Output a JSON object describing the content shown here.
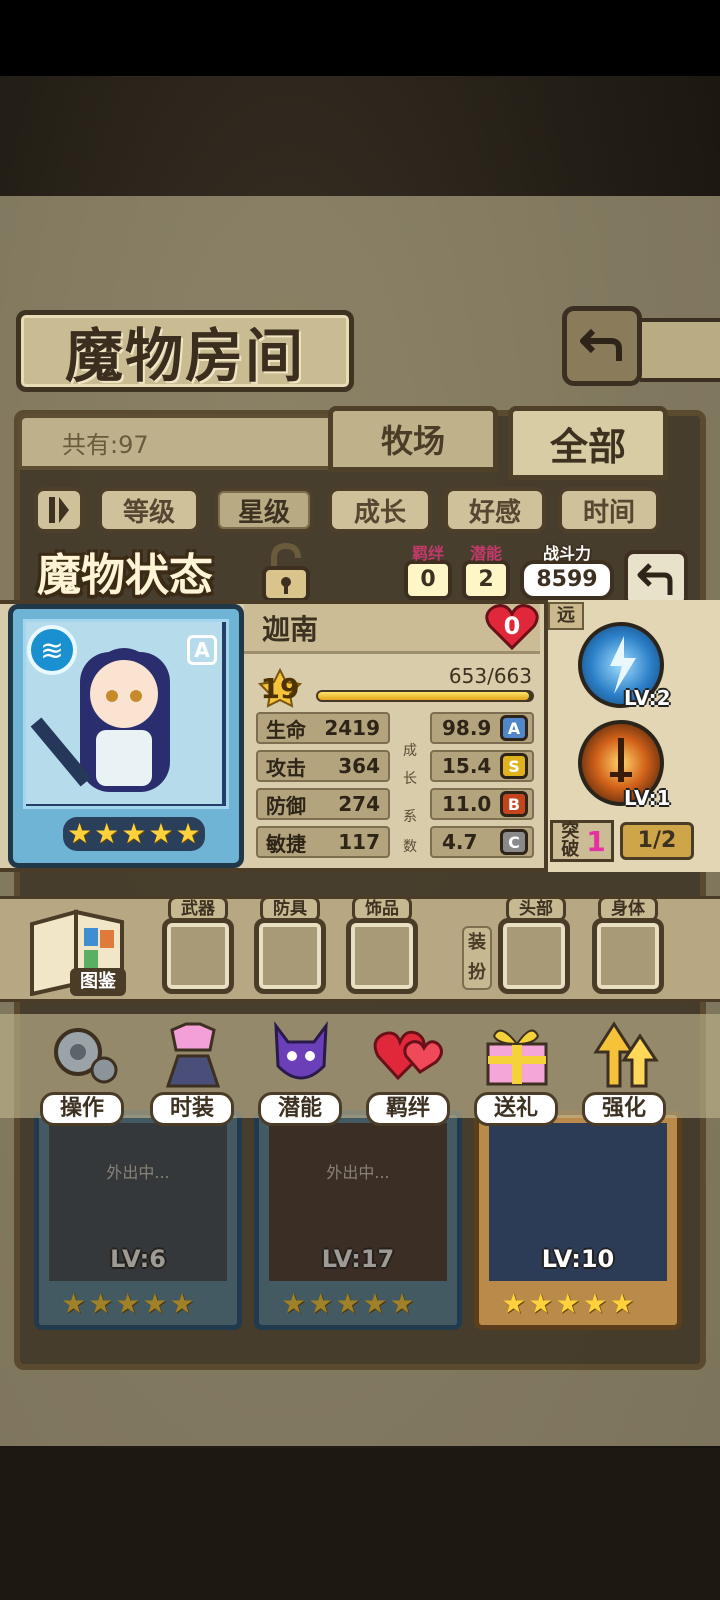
{
  "screen": {
    "title": "魔物房间",
    "count_label": "共有:97",
    "tabs": [
      "牧场",
      "全部"
    ],
    "sort_options": [
      "等级",
      "星级",
      "成长",
      "好感",
      "时间"
    ],
    "active_sort": "星级"
  },
  "status": {
    "title": "魔物状态",
    "bond_label": "羁绊",
    "bond_value": "0",
    "potential_label": "潜能",
    "potential_value": "2",
    "power_label": "战斗力",
    "power_value": "8599"
  },
  "monster": {
    "name": "迦南",
    "rank": "A",
    "stars": 5,
    "affection": "0",
    "level": "19",
    "exp_text": "653/663",
    "exp_fraction": 0.985,
    "stats": [
      {
        "label": "生命",
        "value": "2419",
        "growth": "98.9",
        "grade": "A",
        "grade_color": "#4f87c8"
      },
      {
        "label": "攻击",
        "value": "364",
        "growth": "15.4",
        "grade": "S",
        "grade_color": "#e0b21e"
      },
      {
        "label": "防御",
        "value": "274",
        "growth": "11.0",
        "grade": "B",
        "grade_color": "#c2451e"
      },
      {
        "label": "敏捷",
        "value": "117",
        "growth": "4.7",
        "grade": "C",
        "grade_color": "#8a8a8a"
      }
    ],
    "growth_label": [
      "成",
      "长",
      "系",
      "数"
    ]
  },
  "skills": {
    "range_label": "远",
    "items": [
      {
        "level": "LV:2",
        "icon": "lightning-orb-icon"
      },
      {
        "level": "LV:1",
        "icon": "fire-sword-icon"
      }
    ],
    "breakthrough_label": "突破",
    "breakthrough_count": "1",
    "breakthrough_progress": "1/2"
  },
  "equipment": {
    "codex_label": "图鉴",
    "dress_label": "装扮",
    "slots": [
      "武器",
      "防具",
      "饰品",
      "头部",
      "身体"
    ]
  },
  "actions": [
    "操作",
    "时装",
    "潜能",
    "羁绊",
    "送礼",
    "强化"
  ],
  "roster": [
    {
      "level": "LV:6",
      "status": "外出中...",
      "stars": 5
    },
    {
      "level": "LV:17",
      "status": "外出中...",
      "stars": 5
    },
    {
      "level": "LV:10",
      "status": "",
      "stars": 5
    }
  ],
  "colors": {
    "accent_gold": "#e3a51a",
    "heart_red": "#e0283a",
    "panel_tan": "#d9ccaa",
    "frame_brown": "#4b3c28"
  }
}
